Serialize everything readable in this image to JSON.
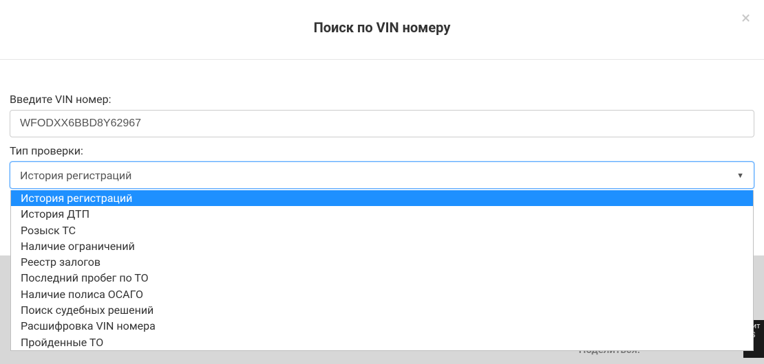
{
  "modal": {
    "title": "Поиск по VIN номеру",
    "close": "×"
  },
  "form": {
    "vin_label": "Введите VIN номер:",
    "vin_value": "WFODXX6BBD8Y62967",
    "check_type_label": "Тип проверки:"
  },
  "select": {
    "selected": "История регистраций",
    "options": [
      "История регистраций",
      "История ДТП",
      "Розыск ТС",
      "Наличие ограничений",
      "Реестр залогов",
      "Последний пробег по ТО",
      "Наличие полиса ОСАГО",
      "Поиск судебных решений",
      "Расшифровка VIN номера",
      "Пройденные ТО"
    ]
  },
  "footer": {
    "share_faded": "Поделиться:",
    "dark": "узит\np S"
  }
}
